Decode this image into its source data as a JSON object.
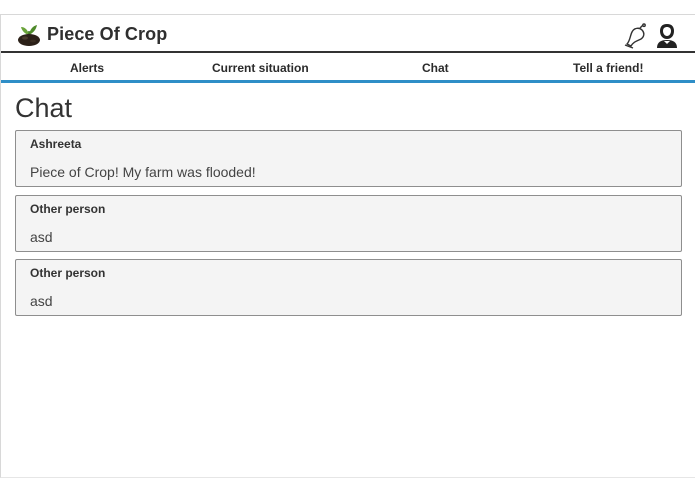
{
  "app": {
    "title": "Piece Of Crop",
    "logo_icon": "plant-in-soil-icon",
    "notification_icon": "bell-icon",
    "profile_icon": "user-avatar-icon"
  },
  "nav": {
    "items": [
      {
        "label": "Alerts"
      },
      {
        "label": "Current situation"
      },
      {
        "label": "Chat",
        "active": true
      },
      {
        "label": "Tell a friend!"
      }
    ]
  },
  "page": {
    "title": "Chat"
  },
  "messages": [
    {
      "author": "Ashreeta",
      "text": "Piece of Crop! My farm was flooded!"
    },
    {
      "author": "Other person",
      "text": "asd"
    },
    {
      "author": "Other person",
      "text": "asd"
    }
  ],
  "colors": {
    "accent": "#2f8ec7",
    "header_rule": "#333333",
    "message_bg": "#f4f4f4",
    "message_border": "#8e8e8e"
  }
}
